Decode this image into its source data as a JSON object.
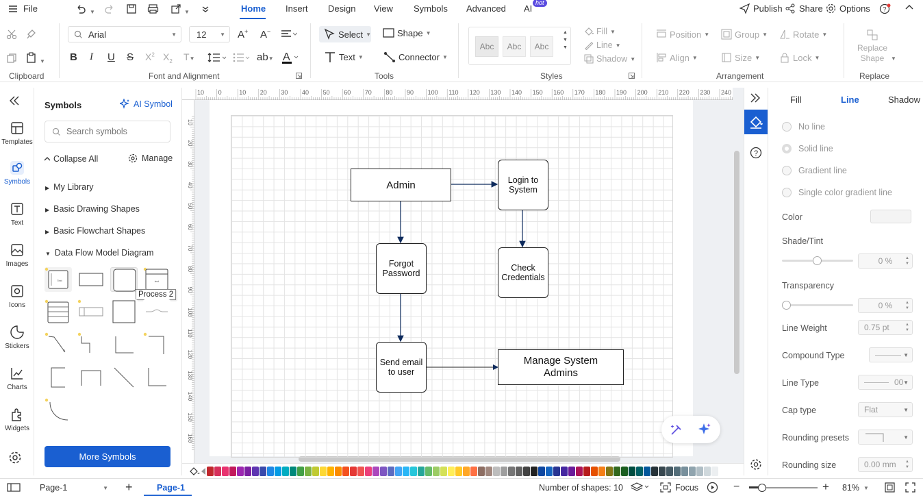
{
  "menubar": {
    "file": "File",
    "tabs": [
      {
        "label": "Home",
        "active": true
      },
      {
        "label": "Insert"
      },
      {
        "label": "Design"
      },
      {
        "label": "View"
      },
      {
        "label": "Symbols"
      },
      {
        "label": "Advanced"
      },
      {
        "label": "AI"
      }
    ],
    "hot_badge": "hot",
    "publish": "Publish",
    "share": "Share",
    "options": "Options"
  },
  "ribbon": {
    "font_name": "Arial",
    "font_size": "12",
    "select": "Select",
    "shape": "Shape",
    "text": "Text",
    "connector": "Connector",
    "style_swatches": [
      "Abc",
      "Abc",
      "Abc"
    ],
    "fill": "Fill",
    "line": "Line",
    "shadow": "Shadow",
    "position": "Position",
    "group": "Group",
    "rotate": "Rotate",
    "align": "Align",
    "size": "Size",
    "lock": "Lock",
    "replace_shape": "Replace Shape",
    "groups": {
      "clipboard": "Clipboard",
      "font": "Font and Alignment",
      "tools": "Tools",
      "styles": "Styles",
      "arrangement": "Arrangement",
      "replace": "Replace"
    }
  },
  "rail": {
    "items": [
      "Templates",
      "Symbols",
      "Text",
      "Images",
      "Icons",
      "Stickers",
      "Charts",
      "Widgets"
    ]
  },
  "symbols": {
    "title": "Symbols",
    "ai_symbol": "AI Symbol",
    "search_placeholder": "Search symbols",
    "collapse_all": "Collapse All",
    "manage": "Manage",
    "categories": [
      "My Library",
      "Basic Drawing Shapes",
      "Basic Flowchart Shapes",
      "Data Flow Model Diagram"
    ],
    "tooltip": "Process 2",
    "more_symbols": "More Symbols"
  },
  "ruler": {
    "top": [
      "10",
      "0",
      "10",
      "20",
      "30",
      "40",
      "50",
      "60",
      "70",
      "80",
      "90",
      "100",
      "110",
      "120",
      "130",
      "140",
      "150",
      "160",
      "170",
      "180",
      "190",
      "200",
      "210",
      "220",
      "230",
      "240"
    ],
    "left": [
      "10",
      "20",
      "30",
      "40",
      "50",
      "60",
      "70",
      "80",
      "90",
      "100",
      "110",
      "120",
      "130",
      "140",
      "150",
      "160"
    ]
  },
  "diagram": {
    "nodes": {
      "admin": "Admin",
      "login": "Login to System",
      "forgot": "Forgot Password",
      "check": "Check Credentials",
      "send": "Send email to user",
      "manage": "Manage System Admins"
    }
  },
  "right_panel": {
    "tabs": [
      "Fill",
      "Line",
      "Shadow"
    ],
    "active_tab": "Line",
    "radios": [
      "No line",
      "Solid line",
      "Gradient line",
      "Single color gradient line"
    ],
    "color_label": "Color",
    "shade_label": "Shade/Tint",
    "shade_value": "0 %",
    "transparency_label": "Transparency",
    "transparency_value": "0 %",
    "line_weight_label": "Line Weight",
    "line_weight_value": "0.75 pt",
    "compound_label": "Compound Type",
    "line_type_label": "Line Type",
    "line_type_value": "00",
    "cap_label": "Cap type",
    "cap_value": "Flat",
    "rounding_presets_label": "Rounding presets",
    "rounding_size_label": "Rounding size",
    "rounding_size_value": "0.00 mm"
  },
  "statusbar": {
    "page_select": "Page-1",
    "page_tab": "Page-1",
    "shape_count": "Number of shapes: 10",
    "focus": "Focus",
    "zoom": "81%"
  },
  "colors": {
    "accent": "#1a5fd1",
    "palette": [
      "#c1272d",
      "#d6305b",
      "#e8336f",
      "#c2185b",
      "#9c27b0",
      "#7b1fa2",
      "#5e35b1",
      "#3949ab",
      "#1e88e5",
      "#039be5",
      "#00acc1",
      "#00897b",
      "#43a047",
      "#7cb342",
      "#c0ca33",
      "#fdd835",
      "#ffb300",
      "#fb8c00",
      "#f4511e",
      "#e53935",
      "#ef5350",
      "#ec407a",
      "#ab47bc",
      "#7e57c2",
      "#5c6bc0",
      "#42a5f5",
      "#29b6f6",
      "#26c6da",
      "#26a69a",
      "#66bb6a",
      "#9ccc65",
      "#d4e157",
      "#ffee58",
      "#ffca28",
      "#ffa726",
      "#ff7043",
      "#8d6e63",
      "#a1887f",
      "#bdbdbd",
      "#9e9e9e",
      "#757575",
      "#616161",
      "#424242",
      "#212121",
      "#0d47a1",
      "#1565c0",
      "#283593",
      "#4527a0",
      "#6a1b9a",
      "#ad1457",
      "#b71c1c",
      "#e65100",
      "#f57f17",
      "#827717",
      "#33691e",
      "#1b5e20",
      "#004d40",
      "#006064",
      "#01579b",
      "#263238",
      "#37474f",
      "#455a64",
      "#546e7a",
      "#78909c",
      "#90a4ae",
      "#b0bec5",
      "#cfd8dc",
      "#eceff1"
    ]
  }
}
